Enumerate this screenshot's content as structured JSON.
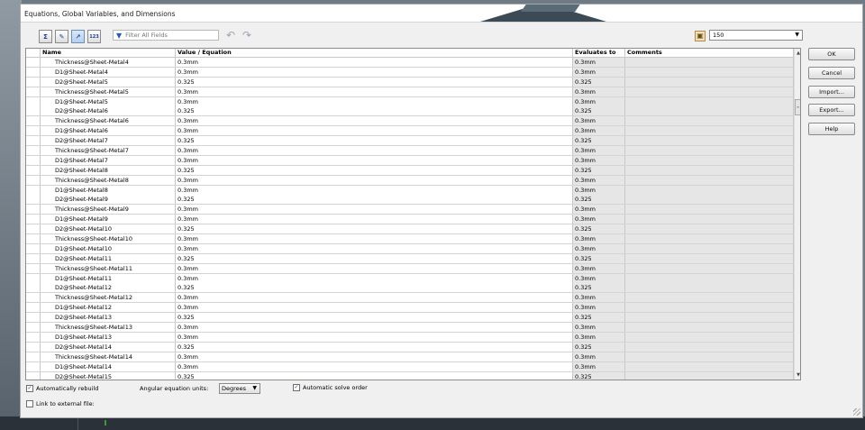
{
  "window": {
    "title": "Equations, Global Variables, and Dimensions"
  },
  "toolbar": {
    "view_buttons": [
      {
        "name": "equation-view-icon",
        "glyph": "Σ"
      },
      {
        "name": "sketch-equation-view-icon",
        "glyph": "✎"
      },
      {
        "name": "dimension-view-icon",
        "glyph": "↗"
      },
      {
        "name": "ordered-view-icon",
        "glyph": "123"
      }
    ],
    "filter_placeholder": "Filter All Fields",
    "precision_value": "150"
  },
  "table": {
    "columns": [
      "Name",
      "Value / Equation",
      "Evaluates to",
      "Comments"
    ],
    "rows": [
      {
        "name": "Thickness@Sheet-Metal4",
        "value": "0.3mm",
        "evaluates": "0.3mm"
      },
      {
        "name": "D1@Sheet-Metal4",
        "value": "0.3mm",
        "evaluates": "0.3mm"
      },
      {
        "name": "D2@Sheet-Metal5",
        "value": "0.325",
        "evaluates": "0.325"
      },
      {
        "name": "Thickness@Sheet-Metal5",
        "value": "0.3mm",
        "evaluates": "0.3mm"
      },
      {
        "name": "D1@Sheet-Metal5",
        "value": "0.3mm",
        "evaluates": "0.3mm"
      },
      {
        "name": "D2@Sheet-Metal6",
        "value": "0.325",
        "evaluates": "0.325"
      },
      {
        "name": "Thickness@Sheet-Metal6",
        "value": "0.3mm",
        "evaluates": "0.3mm"
      },
      {
        "name": "D1@Sheet-Metal6",
        "value": "0.3mm",
        "evaluates": "0.3mm"
      },
      {
        "name": "D2@Sheet-Metal7",
        "value": "0.325",
        "evaluates": "0.325"
      },
      {
        "name": "Thickness@Sheet-Metal7",
        "value": "0.3mm",
        "evaluates": "0.3mm"
      },
      {
        "name": "D1@Sheet-Metal7",
        "value": "0.3mm",
        "evaluates": "0.3mm"
      },
      {
        "name": "D2@Sheet-Metal8",
        "value": "0.325",
        "evaluates": "0.325"
      },
      {
        "name": "Thickness@Sheet-Metal8",
        "value": "0.3mm",
        "evaluates": "0.3mm"
      },
      {
        "name": "D1@Sheet-Metal8",
        "value": "0.3mm",
        "evaluates": "0.3mm"
      },
      {
        "name": "D2@Sheet-Metal9",
        "value": "0.325",
        "evaluates": "0.325"
      },
      {
        "name": "Thickness@Sheet-Metal9",
        "value": "0.3mm",
        "evaluates": "0.3mm"
      },
      {
        "name": "D1@Sheet-Metal9",
        "value": "0.3mm",
        "evaluates": "0.3mm"
      },
      {
        "name": "D2@Sheet-Metal10",
        "value": "0.325",
        "evaluates": "0.325"
      },
      {
        "name": "Thickness@Sheet-Metal10",
        "value": "0.3mm",
        "evaluates": "0.3mm"
      },
      {
        "name": "D1@Sheet-Metal10",
        "value": "0.3mm",
        "evaluates": "0.3mm"
      },
      {
        "name": "D2@Sheet-Metal11",
        "value": "0.325",
        "evaluates": "0.325"
      },
      {
        "name": "Thickness@Sheet-Metal11",
        "value": "0.3mm",
        "evaluates": "0.3mm"
      },
      {
        "name": "D1@Sheet-Metal11",
        "value": "0.3mm",
        "evaluates": "0.3mm"
      },
      {
        "name": "D2@Sheet-Metal12",
        "value": "0.325",
        "evaluates": "0.325"
      },
      {
        "name": "Thickness@Sheet-Metal12",
        "value": "0.3mm",
        "evaluates": "0.3mm"
      },
      {
        "name": "D1@Sheet-Metal12",
        "value": "0.3mm",
        "evaluates": "0.3mm"
      },
      {
        "name": "D2@Sheet-Metal13",
        "value": "0.325",
        "evaluates": "0.325"
      },
      {
        "name": "Thickness@Sheet-Metal13",
        "value": "0.3mm",
        "evaluates": "0.3mm"
      },
      {
        "name": "D1@Sheet-Metal13",
        "value": "0.3mm",
        "evaluates": "0.3mm"
      },
      {
        "name": "D2@Sheet-Metal14",
        "value": "0.325",
        "evaluates": "0.325"
      },
      {
        "name": "Thickness@Sheet-Metal14",
        "value": "0.3mm",
        "evaluates": "0.3mm"
      },
      {
        "name": "D1@Sheet-Metal14",
        "value": "0.3mm",
        "evaluates": "0.3mm"
      },
      {
        "name": "D2@Sheet-Metal15",
        "value": "0.325",
        "evaluates": "0.325"
      }
    ]
  },
  "buttons": {
    "ok": "OK",
    "cancel": "Cancel",
    "import": "Import...",
    "export": "Export...",
    "help": "Help"
  },
  "options": {
    "auto_rebuild": "Automatically rebuild",
    "auto_rebuild_checked": true,
    "angular_units_label": "Angular equation units:",
    "angular_units_value": "Degrees",
    "auto_solve": "Automatic solve order",
    "auto_solve_checked": true,
    "link_external": "Link to external file:",
    "link_external_checked": false
  }
}
